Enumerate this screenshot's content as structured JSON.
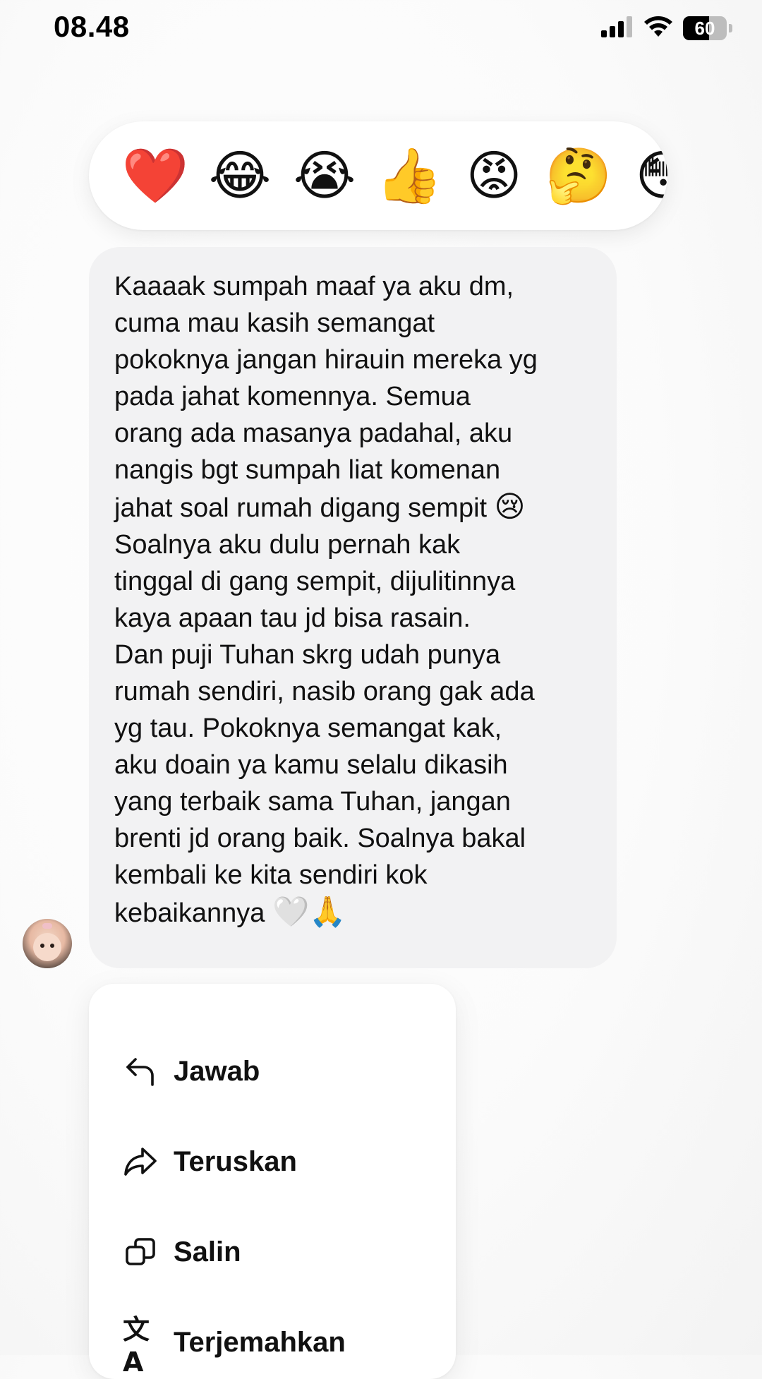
{
  "status_bar": {
    "time": "08.48",
    "battery": "60",
    "icons": [
      "cellular-signal-icon",
      "wifi-icon",
      "battery-icon"
    ]
  },
  "reactions": [
    {
      "name": "heart",
      "emoji": "❤️"
    },
    {
      "name": "laugh",
      "emoji": "😂"
    },
    {
      "name": "cry",
      "emoji": "😭"
    },
    {
      "name": "thumbs-up",
      "emoji": "👍"
    },
    {
      "name": "angry",
      "emoji": "😡"
    },
    {
      "name": "thinking",
      "emoji": "🤔"
    },
    {
      "name": "surprised",
      "emoji": "😳"
    }
  ],
  "message": {
    "text_part1": "Kaaaak sumpah maaf ya aku dm,\ncuma mau kasih semangat\npokoknya jangan hirauin mereka yg\npada jahat komennya. Semua\norang ada masanya padahal, aku\nnangis bgt sumpah liat komenan\njahat soal rumah digang sempit ",
    "emoji1": "😢",
    "text_part2": "\nSoalnya aku dulu pernah kak\ntinggal di gang sempit, dijulitinnya\nkaya apaan tau jd bisa rasain.\nDan puji Tuhan skrg udah punya\nrumah sendiri, nasib orang gak ada\nyg tau. Pokoknya semangat kak,\naku doain ya kamu selalu dikasih\nyang terbaik sama Tuhan, jangan\nbrenti jd orang baik. Soalnya bakal\nkembali ke kita sendiri kok\nkebaikannya ",
    "emoji2": "🤍🙏"
  },
  "context_menu": {
    "items": [
      {
        "label": "Jawab",
        "icon": "reply-icon"
      },
      {
        "label": "Teruskan",
        "icon": "forward-icon"
      },
      {
        "label": "Salin",
        "icon": "copy-icon"
      },
      {
        "label": "Terjemahkan",
        "icon": "translate-icon"
      }
    ],
    "translate_glyph": "文A"
  },
  "colors": {
    "bubble": "#f2f2f3",
    "menu_bg": "#ffffff",
    "text": "#111111"
  }
}
